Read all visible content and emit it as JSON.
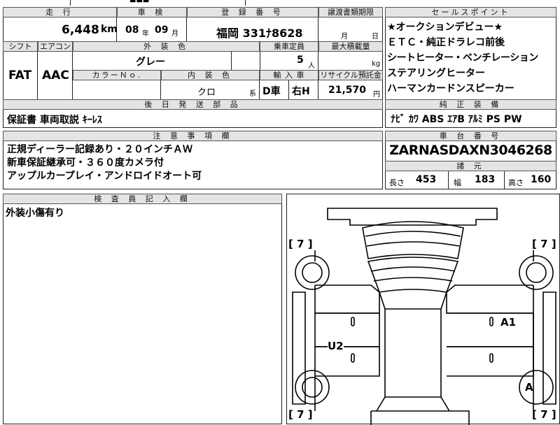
{
  "top_strip": {
    "partial_text": "■■■"
  },
  "vehicle": {
    "mileage_header": "走 行",
    "mileage_value": "6,448",
    "mileage_unit": "km",
    "inspection_header": "車 検",
    "inspection_year": "08",
    "inspection_year_unit": "年",
    "inspection_month": "09",
    "inspection_month_unit": "月",
    "registration_header": "登 録 番 号",
    "registration_value": "福岡 331ﾅ8628",
    "transfer_header": "譲渡書類期限",
    "transfer_month_unit": "月",
    "transfer_day_unit": "日",
    "shift_header": "シフト",
    "shift_value": "FAT",
    "ac_header": "エアコン",
    "ac_value": "AAC",
    "exterior_color_header": "外 装 色",
    "exterior_color_value": "グレー",
    "capacity_header": "乗車定員",
    "capacity_value": "5",
    "capacity_unit": "人",
    "max_load_header": "最大積載量",
    "max_load_unit": "kg",
    "color_no_header": "カラーＮｏ.",
    "color_no_value": "",
    "interior_color_header": "内 装 色",
    "interior_color_value": "クロ",
    "interior_color_unit": "系",
    "import_header": "輸 入 車",
    "import_value_1": "D車",
    "import_value_2": "右H",
    "recycle_header": "リサイクル預託金",
    "recycle_value": "21,570",
    "recycle_unit": "円",
    "later_parts_header": "後 日 発 送 部 品",
    "later_parts_value": "保証書 車両取説 ｷｰﾚｽ"
  },
  "sales_points": {
    "header": "セールスポイント",
    "items": [
      "★オークションデビュー★",
      "ＥＴＣ・純正ドラレコ前後",
      "シートヒーター・ベンチレーション",
      "ステアリングヒーター",
      "ハーマンカードンスピーカー"
    ]
  },
  "equipment": {
    "header": "純 正 装 備",
    "value": "ﾅﾋﾞ ｶﾜ ABS ｴｱB ｱﾙﾐ PS PW"
  },
  "notes": {
    "header": "注 意 事 項 欄",
    "lines": [
      "正規ディーラー記録あり・２０インチＡＷ",
      "新車保証継承可・３６０度カメラ付",
      "アップルカープレイ・アンドロイドオート可"
    ]
  },
  "chassis": {
    "header": "車 台 番 号",
    "value": "ZARNASDAXN3046268"
  },
  "specs": {
    "header": "諸 元",
    "length_label": "長さ",
    "length_value": "453",
    "width_label": "幅",
    "width_value": "183",
    "height_label": "高さ",
    "height_value": "160"
  },
  "inspector": {
    "header": "検 査 員 記 入 欄",
    "text": "外装小傷有り"
  },
  "diagram": {
    "tire_marks": [
      "[ 7 ]",
      "[ 7 ]",
      "[ 7 ]",
      "[ 7 ]"
    ],
    "damage_marks": [
      "A1",
      "U2",
      "A"
    ]
  }
}
